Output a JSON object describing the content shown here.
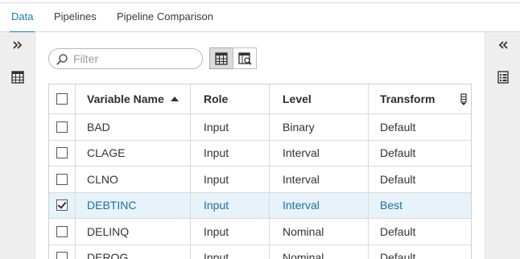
{
  "tabs": [
    {
      "label": "Data",
      "active": true
    },
    {
      "label": "Pipelines",
      "active": false
    },
    {
      "label": "Pipeline Comparison",
      "active": false
    }
  ],
  "filter": {
    "placeholder": "Filter",
    "value": ""
  },
  "table": {
    "columns": [
      "Variable Name",
      "Role",
      "Level",
      "Transform"
    ],
    "sort": {
      "column": "Variable Name",
      "direction": "ascending"
    },
    "rows": [
      {
        "name": "BAD",
        "role": "Input",
        "level": "Binary",
        "transform": "Default",
        "checked": false
      },
      {
        "name": "CLAGE",
        "role": "Input",
        "level": "Interval",
        "transform": "Default",
        "checked": false
      },
      {
        "name": "CLNO",
        "role": "Input",
        "level": "Interval",
        "transform": "Default",
        "checked": false
      },
      {
        "name": "DEBTINC",
        "role": "Input",
        "level": "Interval",
        "transform": "Best",
        "checked": true
      },
      {
        "name": "DELINQ",
        "role": "Input",
        "level": "Nominal",
        "transform": "Default",
        "checked": false
      },
      {
        "name": "DEROG",
        "role": "Input",
        "level": "Nominal",
        "transform": "Default",
        "checked": false
      }
    ]
  },
  "icons": {
    "left_expand": "double-chevron-right-icon",
    "left_table": "table-icon",
    "right_collapse": "double-chevron-left-icon",
    "right_panel": "properties-list-icon",
    "search": "search-icon",
    "grid_view": "grid-view-icon",
    "detail_view": "detail-view-icon",
    "column_menu": "column-menu-icon"
  },
  "colors": {
    "accent": "#1f7ab8",
    "selected_row": "#e7f3fa",
    "side_panel": "#eeeeee"
  }
}
